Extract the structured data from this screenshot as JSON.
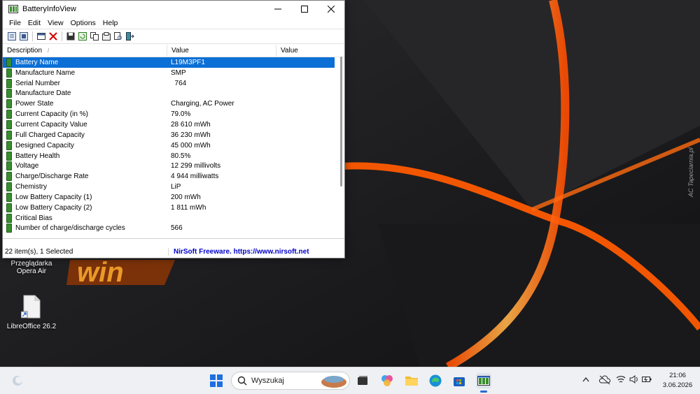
{
  "window": {
    "title": "BatteryInfoView",
    "menus": [
      "File",
      "Edit",
      "View",
      "Options",
      "Help"
    ],
    "columns": {
      "description": "Description",
      "value": "Value",
      "value2": "Value"
    },
    "sort_indicator": "/",
    "rows": [
      {
        "description": "Battery Name",
        "value": "L19M3PF1",
        "selected": true
      },
      {
        "description": "Manufacture Name",
        "value": "SMP"
      },
      {
        "description": "Serial Number",
        "value": "  764"
      },
      {
        "description": "Manufacture Date",
        "value": ""
      },
      {
        "description": "Power State",
        "value": "Charging, AC Power"
      },
      {
        "description": "Current Capacity (in %)",
        "value": "79.0%"
      },
      {
        "description": "Current Capacity Value",
        "value": "28 610 mWh"
      },
      {
        "description": "Full Charged Capacity",
        "value": "36 230 mWh"
      },
      {
        "description": "Designed Capacity",
        "value": "45 000 mWh"
      },
      {
        "description": "Battery Health",
        "value": "80.5%"
      },
      {
        "description": "Voltage",
        "value": "12 299 millivolts"
      },
      {
        "description": "Charge/Discharge Rate",
        "value": "4 944 milliwatts"
      },
      {
        "description": "Chemistry",
        "value": "LiP"
      },
      {
        "description": "Low Battery Capacity (1)",
        "value": "200 mWh"
      },
      {
        "description": "Low Battery Capacity (2)",
        "value": "1 811 mWh"
      },
      {
        "description": "Critical Bias",
        "value": ""
      },
      {
        "description": "Number of charge/discharge cycles",
        "value": "566"
      }
    ],
    "status_count": "22 item(s), 1 Selected",
    "status_link": "NirSoft Freeware. https://www.nirsoft.net"
  },
  "desktop": {
    "icons": [
      {
        "label": "Przeglądarka Opera Air"
      },
      {
        "label": "LibreOffice 26.2"
      }
    ],
    "watermark": "AC Tapeciarnia.pl"
  },
  "taskbar": {
    "search_placeholder": "Wyszukaj",
    "time": "21:06",
    "date": "3.06.2026"
  },
  "colors": {
    "selection": "#0b6fd6",
    "link": "#0000c8",
    "accent_orange": "#ff6a10"
  }
}
